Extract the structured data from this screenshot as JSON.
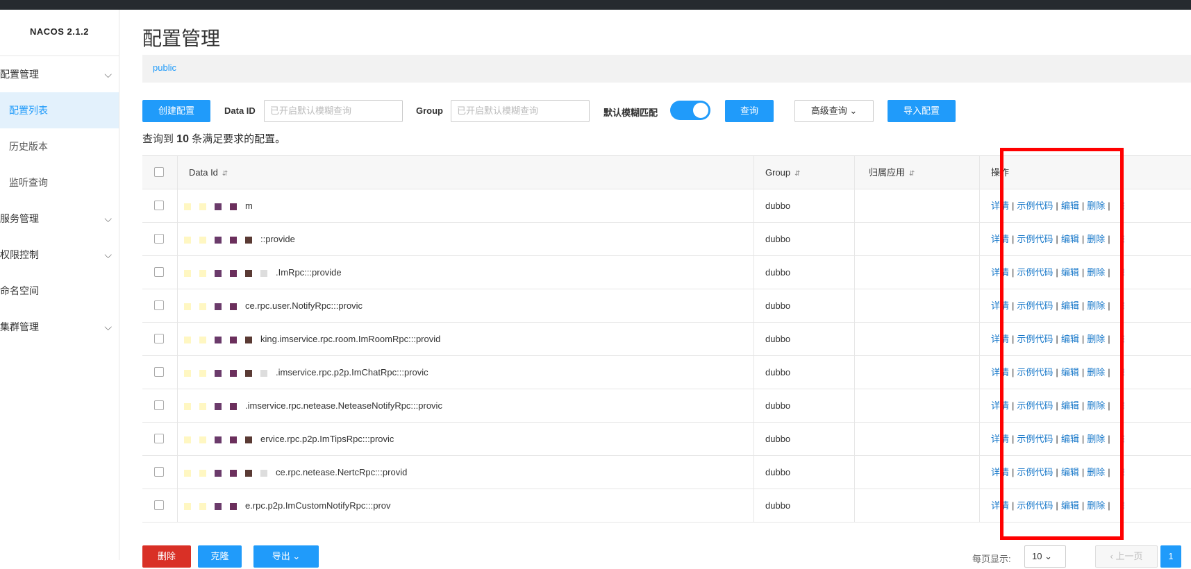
{
  "app": {
    "logo": "NACOS 2.1.2"
  },
  "sidebar": {
    "items": [
      {
        "label": "配置管理",
        "expanded": true
      },
      {
        "label": "配置列表",
        "sub": true,
        "active": true
      },
      {
        "label": "历史版本",
        "sub": true
      },
      {
        "label": "监听查询",
        "sub": true
      },
      {
        "label": "服务管理",
        "expanded": false
      },
      {
        "label": "权限控制",
        "expanded": false
      },
      {
        "label": "命名空间"
      },
      {
        "label": "集群管理",
        "expanded": false
      }
    ],
    "chevron": "⌵"
  },
  "page": {
    "title": "配置管理",
    "namespace": "public"
  },
  "toolbar": {
    "create_label": "创建配置",
    "dataid_label": "Data ID",
    "dataid_placeholder": "已开启默认模糊查询",
    "group_label": "Group",
    "group_placeholder": "已开启默认模糊查询",
    "fuzzy_label": "默认模糊匹配",
    "fuzzy_on": true,
    "query_label": "查询",
    "advanced_label": "高级查询 ⌄",
    "import_label": "导入配置"
  },
  "summary": {
    "prefix": "查询到 ",
    "count": "10",
    "suffix": " 条满足要求的配置。"
  },
  "table": {
    "headers": {
      "dataid": "Data Id",
      "group": "Group",
      "app": "归属应用",
      "ops": "操作",
      "sort": "⇵"
    },
    "rows": [
      {
        "dataid": "m",
        "group": "dubbo",
        "app": ""
      },
      {
        "dataid": "::provide",
        "group": "dubbo",
        "app": ""
      },
      {
        "dataid": ".ImRpc:::provide",
        "group": "dubbo",
        "app": ""
      },
      {
        "dataid": "ce.rpc.user.NotifyRpc:::provic",
        "group": "dubbo",
        "app": ""
      },
      {
        "dataid": "king.imservice.rpc.room.ImRoomRpc:::provid",
        "group": "dubbo",
        "app": ""
      },
      {
        "dataid": ".imservice.rpc.p2p.ImChatRpc:::provic",
        "group": "dubbo",
        "app": ""
      },
      {
        "dataid": ".imservice.rpc.netease.NeteaseNotifyRpc:::provic",
        "group": "dubbo",
        "app": ""
      },
      {
        "dataid": "ervice.rpc.p2p.ImTipsRpc:::provic",
        "group": "dubbo",
        "app": ""
      },
      {
        "dataid": "ce.rpc.netease.NertcRpc:::provid",
        "group": "dubbo",
        "app": ""
      },
      {
        "dataid": "e.rpc.p2p.ImCustomNotifyRpc:::prov",
        "group": "dubbo",
        "app": ""
      }
    ],
    "ops": {
      "detail": "详情",
      "sample": "示例代码",
      "edit": "编辑",
      "delete": "删除",
      "sep": "|",
      "more": "⋮"
    }
  },
  "bottom": {
    "delete_label": "删除",
    "clone_label": "克隆",
    "export_label": "导出 ⌄",
    "page_size_label": "每页显示:",
    "page_size": "10 ⌄",
    "prev_label": "‹ 上一页",
    "current_page": "1"
  },
  "colors": {
    "accent": "#209bfa",
    "danger": "#d93026",
    "highlight_box": "#ff0000"
  }
}
